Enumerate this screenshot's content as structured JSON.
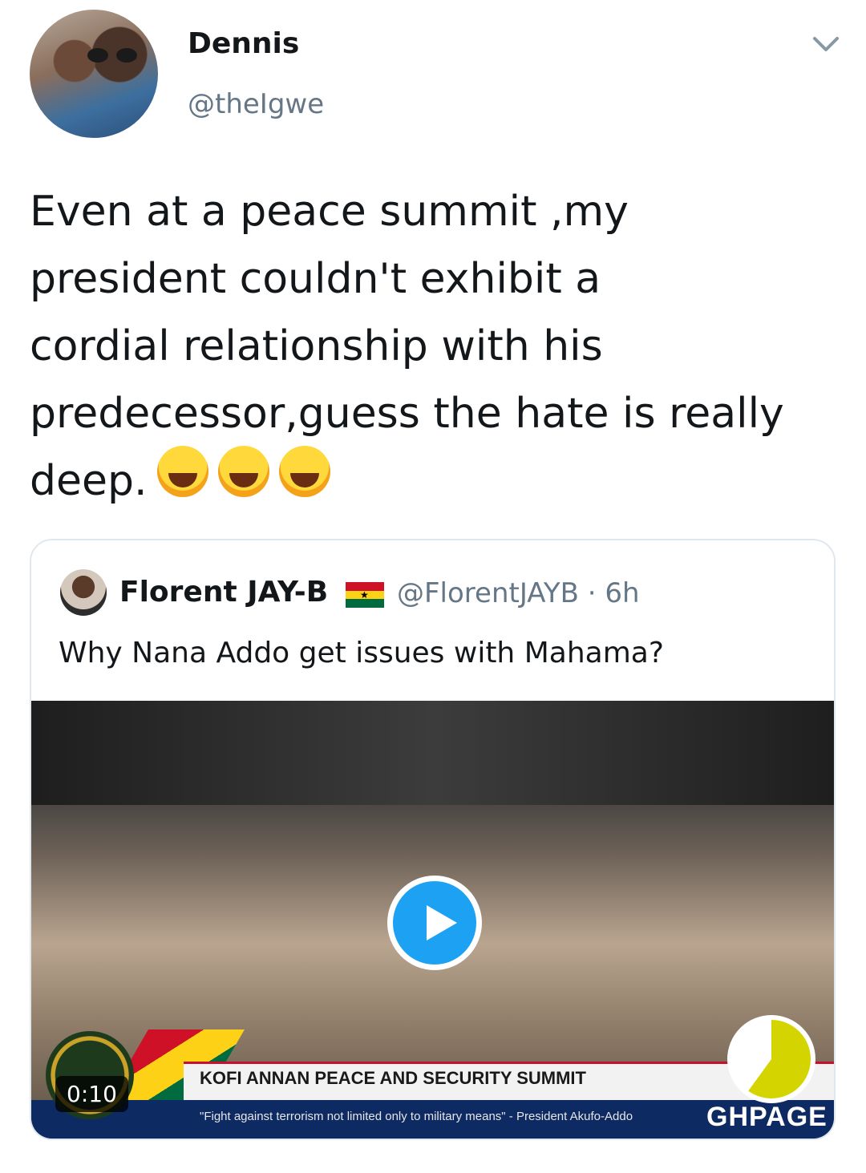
{
  "author": {
    "display_name": "Dennis",
    "handle": "@theIgwe"
  },
  "tweet": {
    "text": "Even at a peace summit ,my\npresident couldn't exhibit a\ncordial relationship with his\npredecessor,guess the hate is really\ndeep.",
    "emojis": [
      "face-with-tears-of-joy",
      "rolling-on-the-floor-laughing",
      "rolling-on-the-floor-laughing"
    ]
  },
  "quoted_tweet": {
    "display_name": "Florent JAY-B",
    "flag": "ghana-flag",
    "handle_time": "@FlorentJAYB · 6h",
    "text": "Why Nana Addo get issues with Mahama?",
    "video": {
      "duration": "0:10",
      "banner_title": "KOFI ANNAN PEACE AND SECURITY SUMMIT",
      "ticker": "\"Fight against terrorism not limited only to military means\" - President Akufo-Addo",
      "watermark": "GHPAGE"
    }
  },
  "colors": {
    "accent": "#1da1f2",
    "secondary_text": "#657786",
    "border": "#e1e8ed"
  }
}
